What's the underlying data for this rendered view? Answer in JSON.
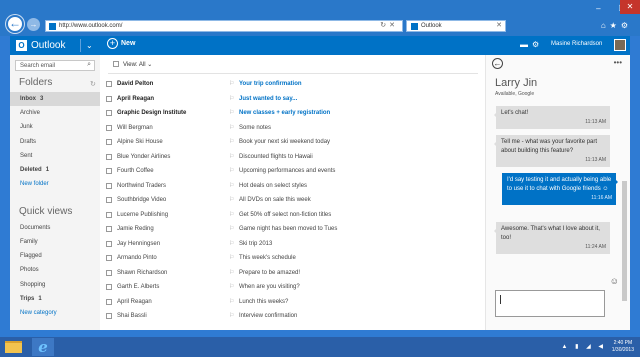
{
  "browser": {
    "url": "http://www.outlook.com/",
    "tab_title": "Outlook"
  },
  "header": {
    "brand": "Outlook",
    "new_label": "New",
    "user_name": "Masine Richardson"
  },
  "sidebar": {
    "search_placeholder": "Search email",
    "folders_title": "Folders",
    "folders": [
      {
        "label": "Inbox",
        "count": "3"
      },
      {
        "label": "Archive",
        "count": ""
      },
      {
        "label": "Junk",
        "count": ""
      },
      {
        "label": "Drafts",
        "count": ""
      },
      {
        "label": "Sent",
        "count": ""
      },
      {
        "label": "Deleted",
        "count": "1"
      }
    ],
    "new_folder": "New folder",
    "quick_views_title": "Quick views",
    "quick_views": [
      {
        "label": "Documents",
        "count": ""
      },
      {
        "label": "Family",
        "count": ""
      },
      {
        "label": "Flagged",
        "count": ""
      },
      {
        "label": "Photos",
        "count": ""
      },
      {
        "label": "Shopping",
        "count": ""
      },
      {
        "label": "Trips",
        "count": "1"
      }
    ],
    "new_category": "New category"
  },
  "list": {
    "view_label": "View: All",
    "messages": [
      {
        "sender": "David Pelton",
        "subject": "Your trip confirmation",
        "unread": true
      },
      {
        "sender": "April Reagan",
        "subject": "Just wanted to say...",
        "unread": true
      },
      {
        "sender": "Graphic Design Institute",
        "subject": "New classes + early registration",
        "unread": true
      },
      {
        "sender": "Will Bergman",
        "subject": "Some notes",
        "unread": false
      },
      {
        "sender": "Alpine Ski House",
        "subject": "Book your next ski weekend today",
        "unread": false
      },
      {
        "sender": "Blue Yonder Airlines",
        "subject": "Discounted flights to Hawaii",
        "unread": false
      },
      {
        "sender": "Fourth Coffee",
        "subject": "Upcoming performances and events",
        "unread": false
      },
      {
        "sender": "Northwind Traders",
        "subject": "Hot deals on select styles",
        "unread": false
      },
      {
        "sender": "Southbridge Video",
        "subject": "All DVDs on sale this week",
        "unread": false
      },
      {
        "sender": "Lucerne Publishing",
        "subject": "Get 50% off select non-fiction titles",
        "unread": false
      },
      {
        "sender": "Jamie Reding",
        "subject": "Game night has been moved to Tues",
        "unread": false
      },
      {
        "sender": "Jay Henningsen",
        "subject": "Ski trip 2013",
        "unread": false
      },
      {
        "sender": "Armando Pinto",
        "subject": "This week's schedule",
        "unread": false
      },
      {
        "sender": "Shawn Richardson",
        "subject": "Prepare to be amazed!",
        "unread": false
      },
      {
        "sender": "Garth E. Alberts",
        "subject": "When are you visiting?",
        "unread": false
      },
      {
        "sender": "April Reagan",
        "subject": "Lunch this weeks?",
        "unread": false
      },
      {
        "sender": "Shai Bassli",
        "subject": "Interview confirmation",
        "unread": false
      }
    ]
  },
  "chat": {
    "name": "Larry Jin",
    "status": "Available, Google",
    "messages": [
      {
        "text": "Let's chat!",
        "time": "11:13 AM",
        "mine": false
      },
      {
        "text": "Tell me - what was your favorite part about building this feature?",
        "time": "11:13 AM",
        "mine": false
      },
      {
        "text": "I'd say testing it and actually being able to use it to chat with Google friends ☺",
        "time": "11:16 AM",
        "mine": true
      },
      {
        "text": "Awesome. That's what I love about it, too!",
        "time": "11:24 AM",
        "mine": false
      }
    ]
  },
  "taskbar": {
    "time": "2:40 PM",
    "date": "1/30/2013"
  },
  "colors": {
    "accent": "#0072c6",
    "desktop": "#2f7bd3"
  }
}
